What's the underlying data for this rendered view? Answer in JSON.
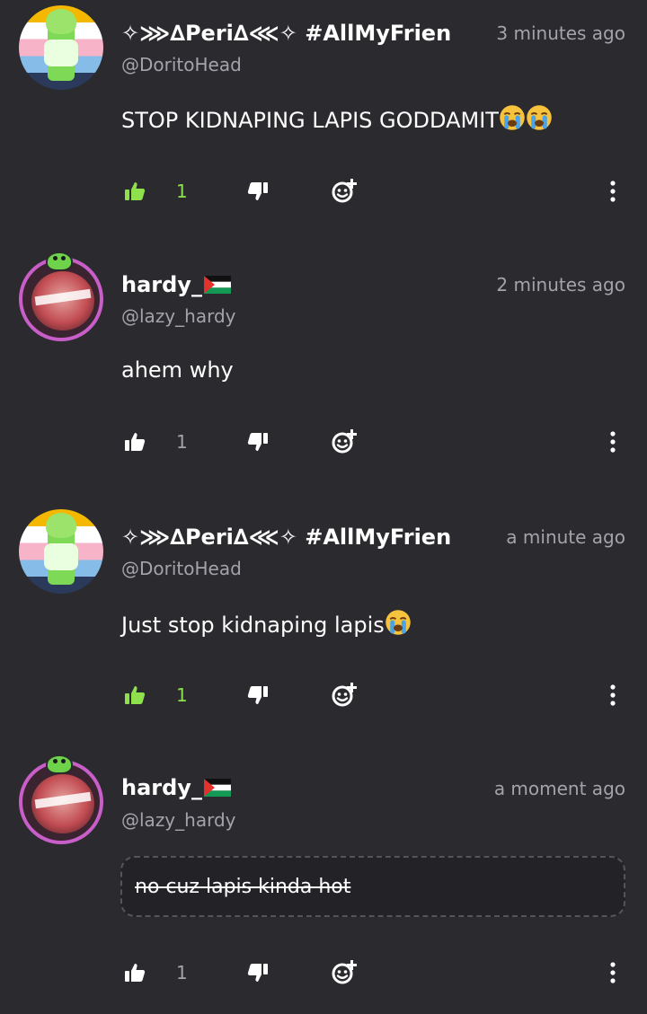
{
  "comments": [
    {
      "name": "✧⋙∆Peri∆⋘✧ #AllMyFrien",
      "handle": "@DoritoHead",
      "time": "3 minutes ago",
      "text": "STOP KIDNAPING LAPIS GODDAMIT",
      "likes": "1",
      "liked": true
    },
    {
      "name": "hardy_",
      "handle": "@lazy_hardy",
      "time": "2 minutes ago",
      "text": "ahem why",
      "likes": "1",
      "liked": false
    },
    {
      "name": "✧⋙∆Peri∆⋘✧ #AllMyFrien",
      "handle": "@DoritoHead",
      "time": "a minute ago",
      "text": "Just stop kidnaping lapis",
      "likes": "1",
      "liked": true
    },
    {
      "name": "hardy_",
      "handle": "@lazy_hardy",
      "time": "a moment ago",
      "text": "no cuz lapis kinda hot",
      "likes": "1",
      "liked": false
    }
  ],
  "icons": {
    "like": "thumbs-up-icon",
    "dislike": "thumbs-down-icon",
    "react": "add-reaction-icon",
    "more": "more-vertical-icon",
    "emoji": "crying-face-emoji",
    "flag": "palestine-flag-icon"
  },
  "colors": {
    "background": "#2b2a2f",
    "liked_accent": "#8ee04c",
    "muted_text": "#a4a3ab",
    "avatar_ring": "#c85ec8"
  }
}
